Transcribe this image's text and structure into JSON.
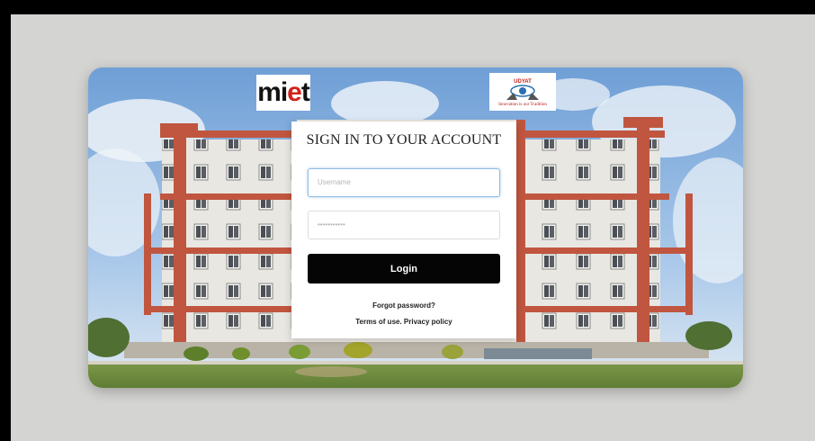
{
  "login": {
    "title": "SIGN IN TO YOUR ACCOUNT",
    "username_placeholder": "Username",
    "password_placeholder": "•••••••••••",
    "login_button": "Login",
    "forgot_password": "Forgot password?",
    "terms": "Terms of use.",
    "privacy": "Privacy policy"
  },
  "logos": {
    "left_prefix": "mi",
    "left_accent": "e",
    "left_suffix": "t",
    "right_name": "UDYAT",
    "right_tagline": "Innovation is our Tradition"
  },
  "colors": {
    "button": "#050505",
    "building_red": "#c0563f",
    "logo_accent": "#d0221b"
  }
}
